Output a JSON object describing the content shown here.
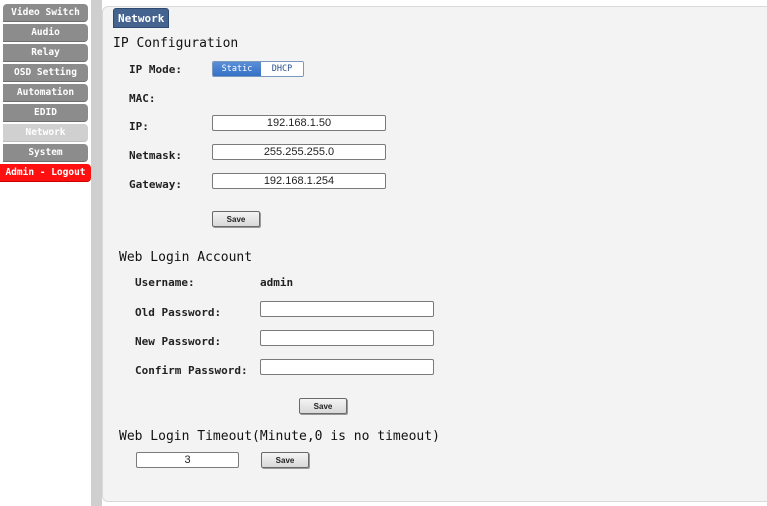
{
  "sidebar": {
    "items": [
      {
        "label": "Video Switch",
        "active": false
      },
      {
        "label": "Audio",
        "active": false
      },
      {
        "label": "Relay",
        "active": false
      },
      {
        "label": "OSD Setting",
        "active": false
      },
      {
        "label": "Automation",
        "active": false
      },
      {
        "label": "EDID",
        "active": false
      },
      {
        "label": "Network",
        "active": true
      },
      {
        "label": "System",
        "active": false
      }
    ],
    "logout_label": "Admin - Logout"
  },
  "tab": {
    "label": "Network"
  },
  "ip_config": {
    "heading": "IP Configuration",
    "mode_label": "IP Mode:",
    "mode_options": [
      "Static",
      "DHCP"
    ],
    "mode_selected": "Static",
    "mac_label": "MAC:",
    "mac_value": "",
    "ip_label": "IP:",
    "ip_value": "192.168.1.50",
    "netmask_label": "Netmask:",
    "netmask_value": "255.255.255.0",
    "gateway_label": "Gateway:",
    "gateway_value": "192.168.1.254",
    "save_label": "Save"
  },
  "web_login": {
    "heading": "Web Login Account",
    "username_label": "Username:",
    "username_value": "admin",
    "old_password_label": "Old Password:",
    "new_password_label": "New Password:",
    "confirm_password_label": "Confirm Password:",
    "old_password_value": "",
    "new_password_value": "",
    "confirm_password_value": "",
    "save_label": "Save"
  },
  "timeout": {
    "heading": "Web Login Timeout(Minute,0 is no timeout)",
    "value": "3",
    "save_label": "Save"
  },
  "colors": {
    "tab": "#44638f",
    "nav_inactive": "#8c8c8c",
    "nav_active": "#d0d0d0",
    "logout": "#ff1010",
    "selected_mode": "#3470c6"
  }
}
